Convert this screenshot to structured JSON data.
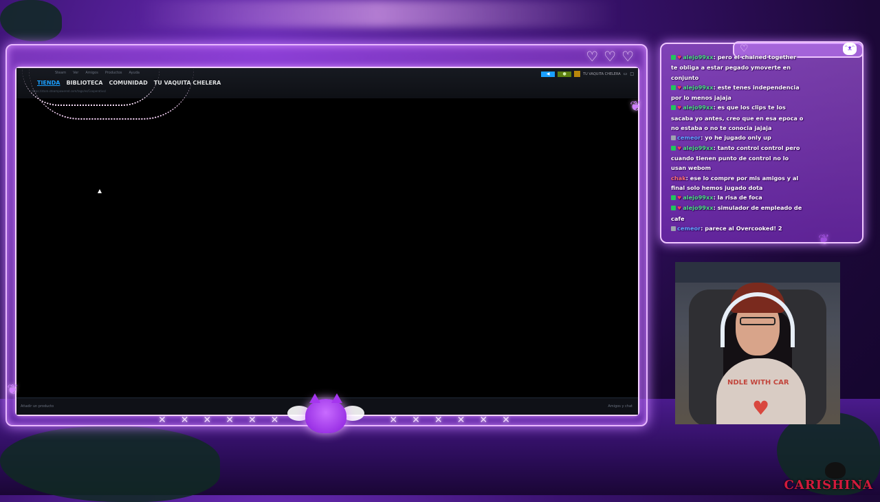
{
  "steam": {
    "menu": [
      "Steam",
      "Ver",
      "Amigos",
      "Productos",
      "Ayuda"
    ],
    "nav": [
      "TIENDA",
      "BIBLIOTECA",
      "COMUNIDAD",
      "TU VAQUITA CHELERA"
    ],
    "url": "https://store.steampowered.com/tags/es/Cooperativo/",
    "user_label": "TU VAQUITA CHELERA",
    "add_product": "Añadir un producto",
    "friends_chat": "Amigos y chat"
  },
  "chat": {
    "messages": [
      {
        "badge": "sub",
        "user": "alejo99xx",
        "user_color": "#4ade80",
        "text": "pero el chained together te obliga a estar pegado ymoverte en conjunto"
      },
      {
        "badge": "sub",
        "user": "alejo99xx",
        "user_color": "#4ade80",
        "text": "este tenes independencia por lo menos jajaja"
      },
      {
        "badge": "sub",
        "user": "alejo99xx",
        "user_color": "#4ade80",
        "text": "es que los clips te los sacaba yo antes, creo que en esa epoca o no estaba o no te conocia jajaja"
      },
      {
        "badge": "pin",
        "user": "cemeor",
        "user_color": "#60a5fa",
        "text": "yo he jugado only up"
      },
      {
        "badge": "sub",
        "user": "alejo99xx",
        "user_color": "#4ade80",
        "text": "tanto control control pero cuando tienen punto de control no lo usan webom"
      },
      {
        "badge": "none",
        "user": "chak",
        "user_color": "#f87171",
        "text": "ese lo compre por mis amigos y al final solo hemos jugado dota"
      },
      {
        "badge": "sub",
        "user": "alejo99xx",
        "user_color": "#4ade80",
        "text": "la risa de foca"
      },
      {
        "badge": "sub",
        "user": "alejo99xx",
        "user_color": "#4ade80",
        "text": "simulador de empleado de cafe"
      },
      {
        "badge": "pin",
        "user": "cemeor",
        "user_color": "#60a5fa",
        "text": "parece al Overcooked! 2"
      }
    ]
  },
  "webcam": {
    "shirt_text": "NDLE WITH CAR"
  },
  "watermark": "CARISHINA",
  "colors": {
    "frame_glow": "#c77dff",
    "steam_blue": "#1a9fff",
    "steam_green": "#5c7e10"
  }
}
